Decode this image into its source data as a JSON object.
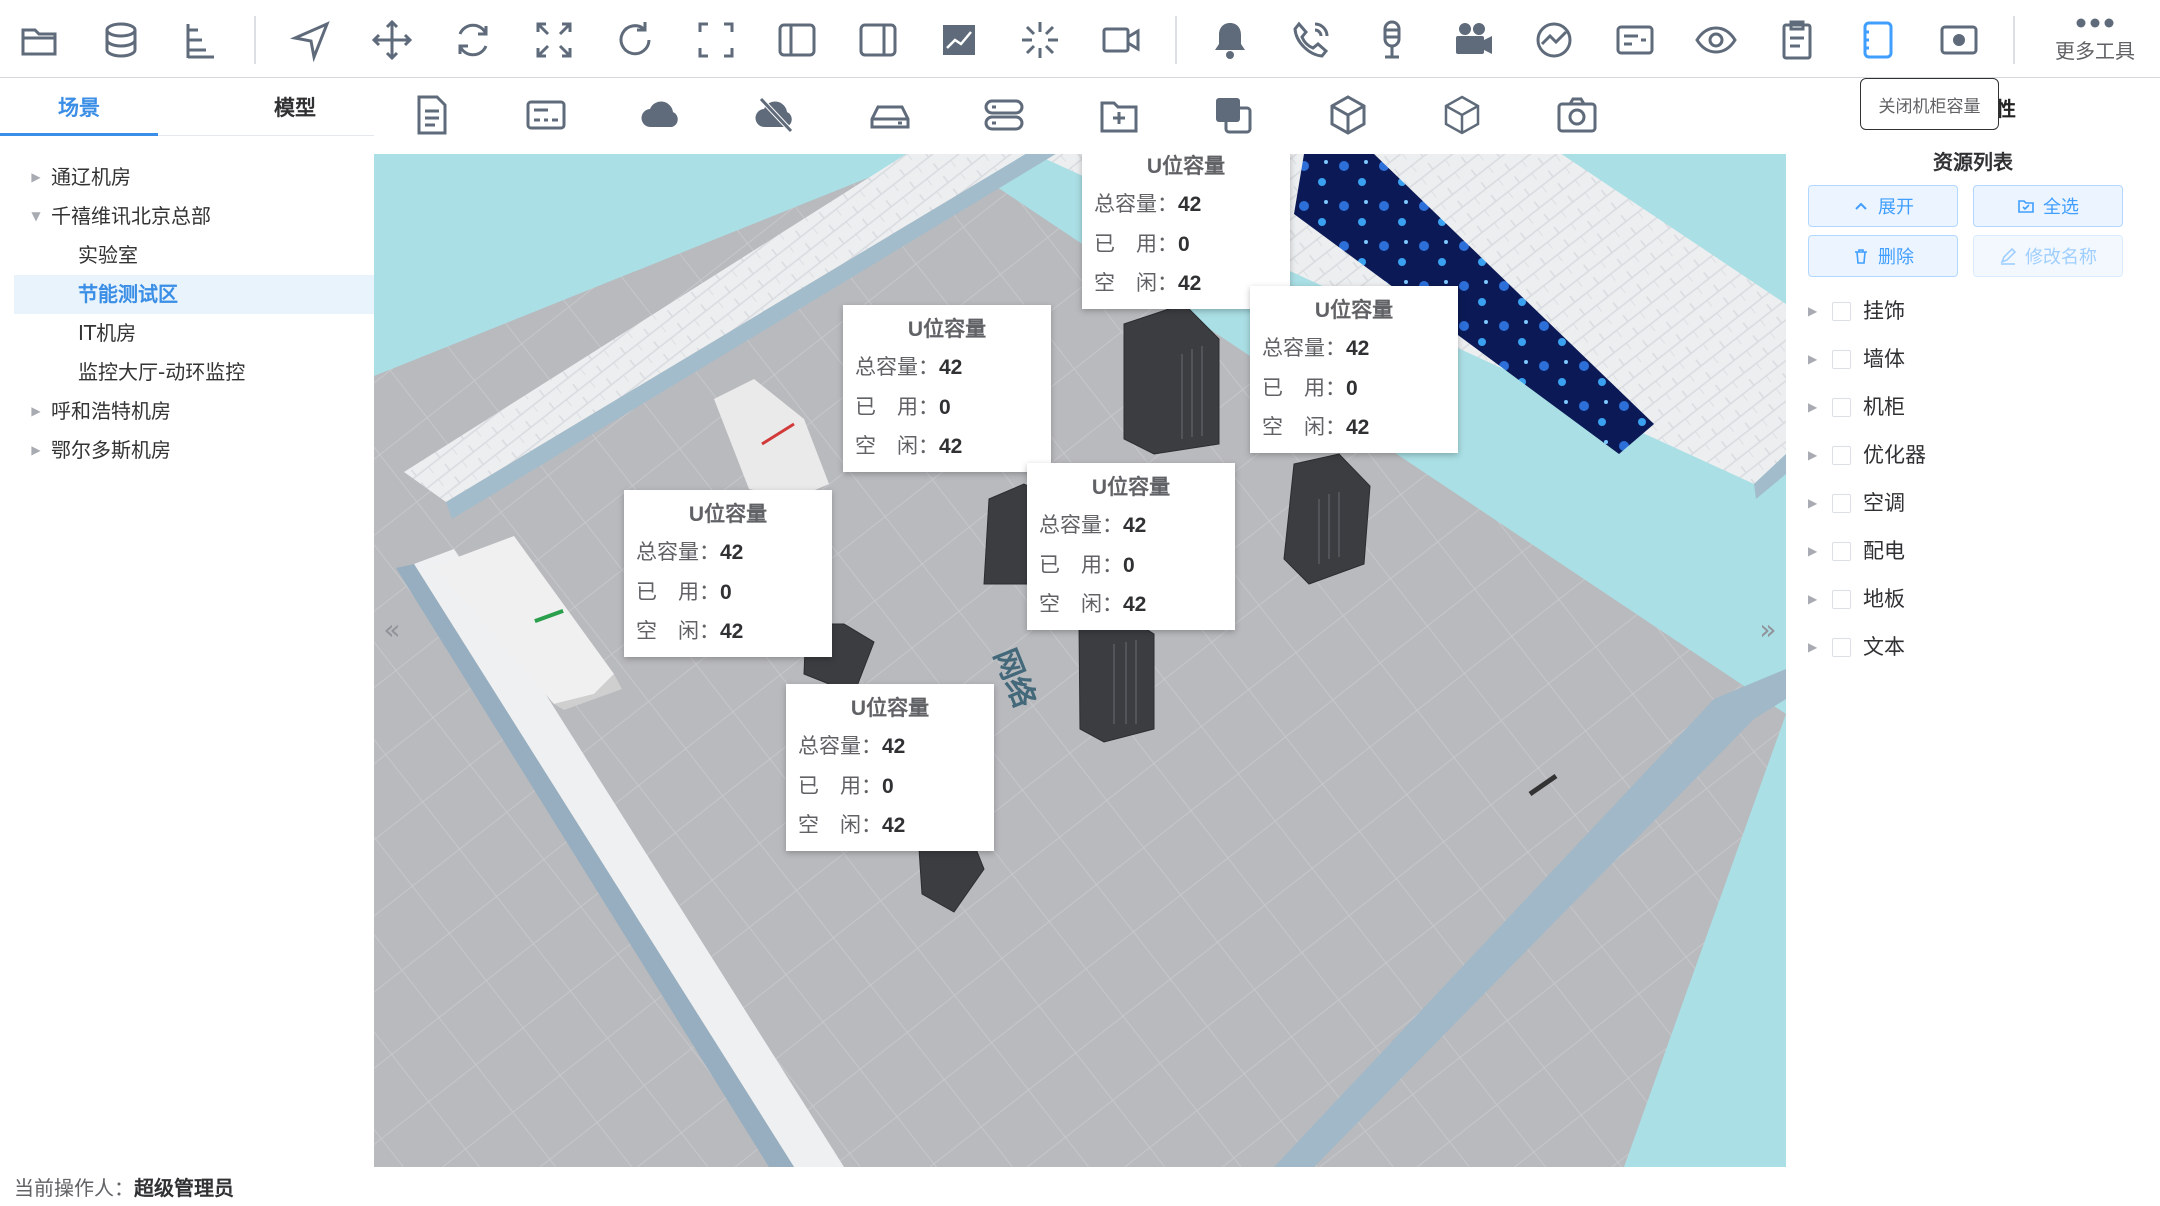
{
  "toolbar": {
    "more_tools_label": "更多工具",
    "tooltip": "关闭机柜容量",
    "right_tab_partial": "性",
    "icons": [
      "folder-open-icon",
      "database-icon",
      "hierarchy-icon",
      "navigation-icon",
      "move-icon",
      "rotate-icon",
      "scale-icon",
      "refresh-icon",
      "fullscreen-icon",
      "left-panel-icon",
      "right-panel-icon",
      "chart-icon",
      "sparkle-icon",
      "video-camera-icon",
      "bell-icon",
      "phone-icon",
      "microphone-icon",
      "movie-camera-icon",
      "gauge-icon",
      "card-icon",
      "eye-icon",
      "clipboard-icon",
      "capacity-icon",
      "record-icon"
    ]
  },
  "secondary_toolbar": {
    "icons": [
      "document-icon",
      "terminal-icon",
      "cloud-icon",
      "cloud-off-icon",
      "hard-drive-icon",
      "server-icon",
      "folder-plus-icon",
      "layers-icon",
      "cube-icon",
      "cube-outline-icon",
      "camera-icon"
    ]
  },
  "left_panel": {
    "tabs": [
      "场景",
      "模型"
    ],
    "tree": [
      {
        "label": "通辽机房",
        "level": 1,
        "expanded": false
      },
      {
        "label": "千禧维讯北京总部",
        "level": 1,
        "expanded": true
      },
      {
        "label": "实验室",
        "level": 2
      },
      {
        "label": "节能测试区",
        "level": 2,
        "active": true
      },
      {
        "label": "IT机房",
        "level": 2
      },
      {
        "label": "监控大厅-动环监控",
        "level": 2
      },
      {
        "label": "呼和浩特机房",
        "level": 1,
        "expanded": false
      },
      {
        "label": "鄂尔多斯机房",
        "level": 1,
        "expanded": false
      }
    ]
  },
  "status": {
    "operator_label": "当前操作人：",
    "operator_name": "超级管理员"
  },
  "viewport": {
    "capacity_popups": [
      {
        "title": "U位容量",
        "total_label": "总容量：",
        "total": "42",
        "used_label": "已　用：",
        "used": "0",
        "free_label": "空　闲：",
        "free": "42"
      },
      {
        "title": "U位容量",
        "total_label": "总容量：",
        "total": "42",
        "used_label": "已　用：",
        "used": "0",
        "free_label": "空　闲：",
        "free": "42"
      },
      {
        "title": "U位容量",
        "total_label": "总容量：",
        "total": "42",
        "used_label": "已　用：",
        "used": "0",
        "free_label": "空　闲：",
        "free": "42"
      },
      {
        "title": "U位容量",
        "total_label": "总容量：",
        "total": "42",
        "used_label": "已　用：",
        "used": "0",
        "free_label": "空　闲：",
        "free": "42"
      },
      {
        "title": "U位容量",
        "total_label": "总容量：",
        "total": "42",
        "used_label": "已　用：",
        "used": "0",
        "free_label": "空　闲：",
        "free": "42"
      },
      {
        "title": "U位容量",
        "total_label": "总容量：",
        "total": "42",
        "used_label": "已　用：",
        "used": "0",
        "free_label": "空　闲：",
        "free": "42"
      }
    ],
    "collapse_left": "«",
    "collapse_right": "»"
  },
  "right_panel": {
    "title": "资源列表",
    "buttons": {
      "expand": "展开",
      "select_all": "全选",
      "delete": "删除",
      "rename": "修改名称"
    },
    "items": [
      "挂饰",
      "墙体",
      "机柜",
      "优化器",
      "空调",
      "配电",
      "地板",
      "文本"
    ]
  },
  "colors": {
    "accent": "#3a8ee6",
    "icon": "#5f6b7a",
    "active_icon": "#409eff",
    "floor": "#b9babe",
    "wall": "#e6e8eb"
  }
}
